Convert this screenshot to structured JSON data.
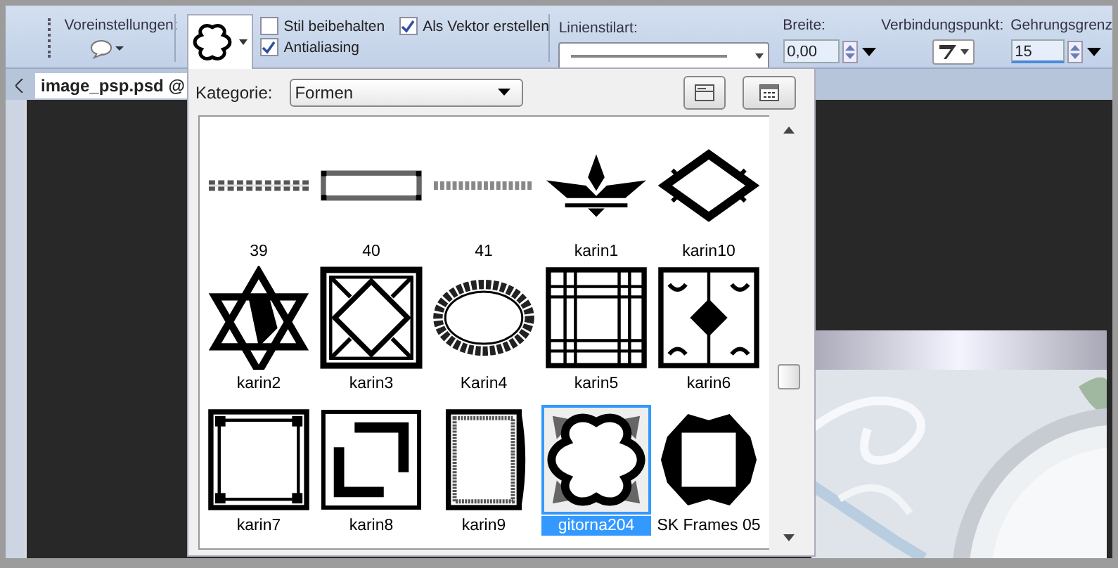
{
  "toolbar": {
    "presets_label": "Voreinstellungen:",
    "checkboxes": [
      {
        "label": "Stil beibehalten",
        "checked": false
      },
      {
        "label": "Als Vektor erstellen",
        "checked": true
      },
      {
        "label": "Antialiasing",
        "checked": true
      }
    ],
    "line_style_label": "Linienstilart:",
    "width_label": "Breite:",
    "width_value": "0,00",
    "join_label": "Verbindungspunkt:",
    "miter_label": "Gehrungsgrenz",
    "miter_value": "15"
  },
  "document_tab": "image_psp.psd @",
  "shape_picker": {
    "category_label": "Kategorie:",
    "category_value": "Formen",
    "shapes": [
      {
        "name": "39",
        "kind": "chain",
        "selected": false
      },
      {
        "name": "40",
        "kind": "bar",
        "selected": false
      },
      {
        "name": "41",
        "kind": "crosses",
        "selected": false
      },
      {
        "name": "karin1",
        "kind": "fleur",
        "selected": false
      },
      {
        "name": "karin10",
        "kind": "diamond",
        "selected": false
      },
      {
        "name": "karin2",
        "kind": "star",
        "selected": false
      },
      {
        "name": "karin3",
        "kind": "square",
        "selected": false
      },
      {
        "name": "Karin4",
        "kind": "wreath",
        "selected": false
      },
      {
        "name": "karin5",
        "kind": "grid",
        "selected": false
      },
      {
        "name": "karin6",
        "kind": "quad",
        "selected": false
      },
      {
        "name": "karin7",
        "kind": "corners",
        "selected": false
      },
      {
        "name": "karin8",
        "kind": "brackets",
        "selected": false
      },
      {
        "name": "karin9",
        "kind": "border",
        "selected": false
      },
      {
        "name": "gitorna204",
        "kind": "quatrefoil",
        "selected": true
      },
      {
        "name": "SK Frames 05",
        "kind": "octagon",
        "selected": false
      }
    ]
  }
}
